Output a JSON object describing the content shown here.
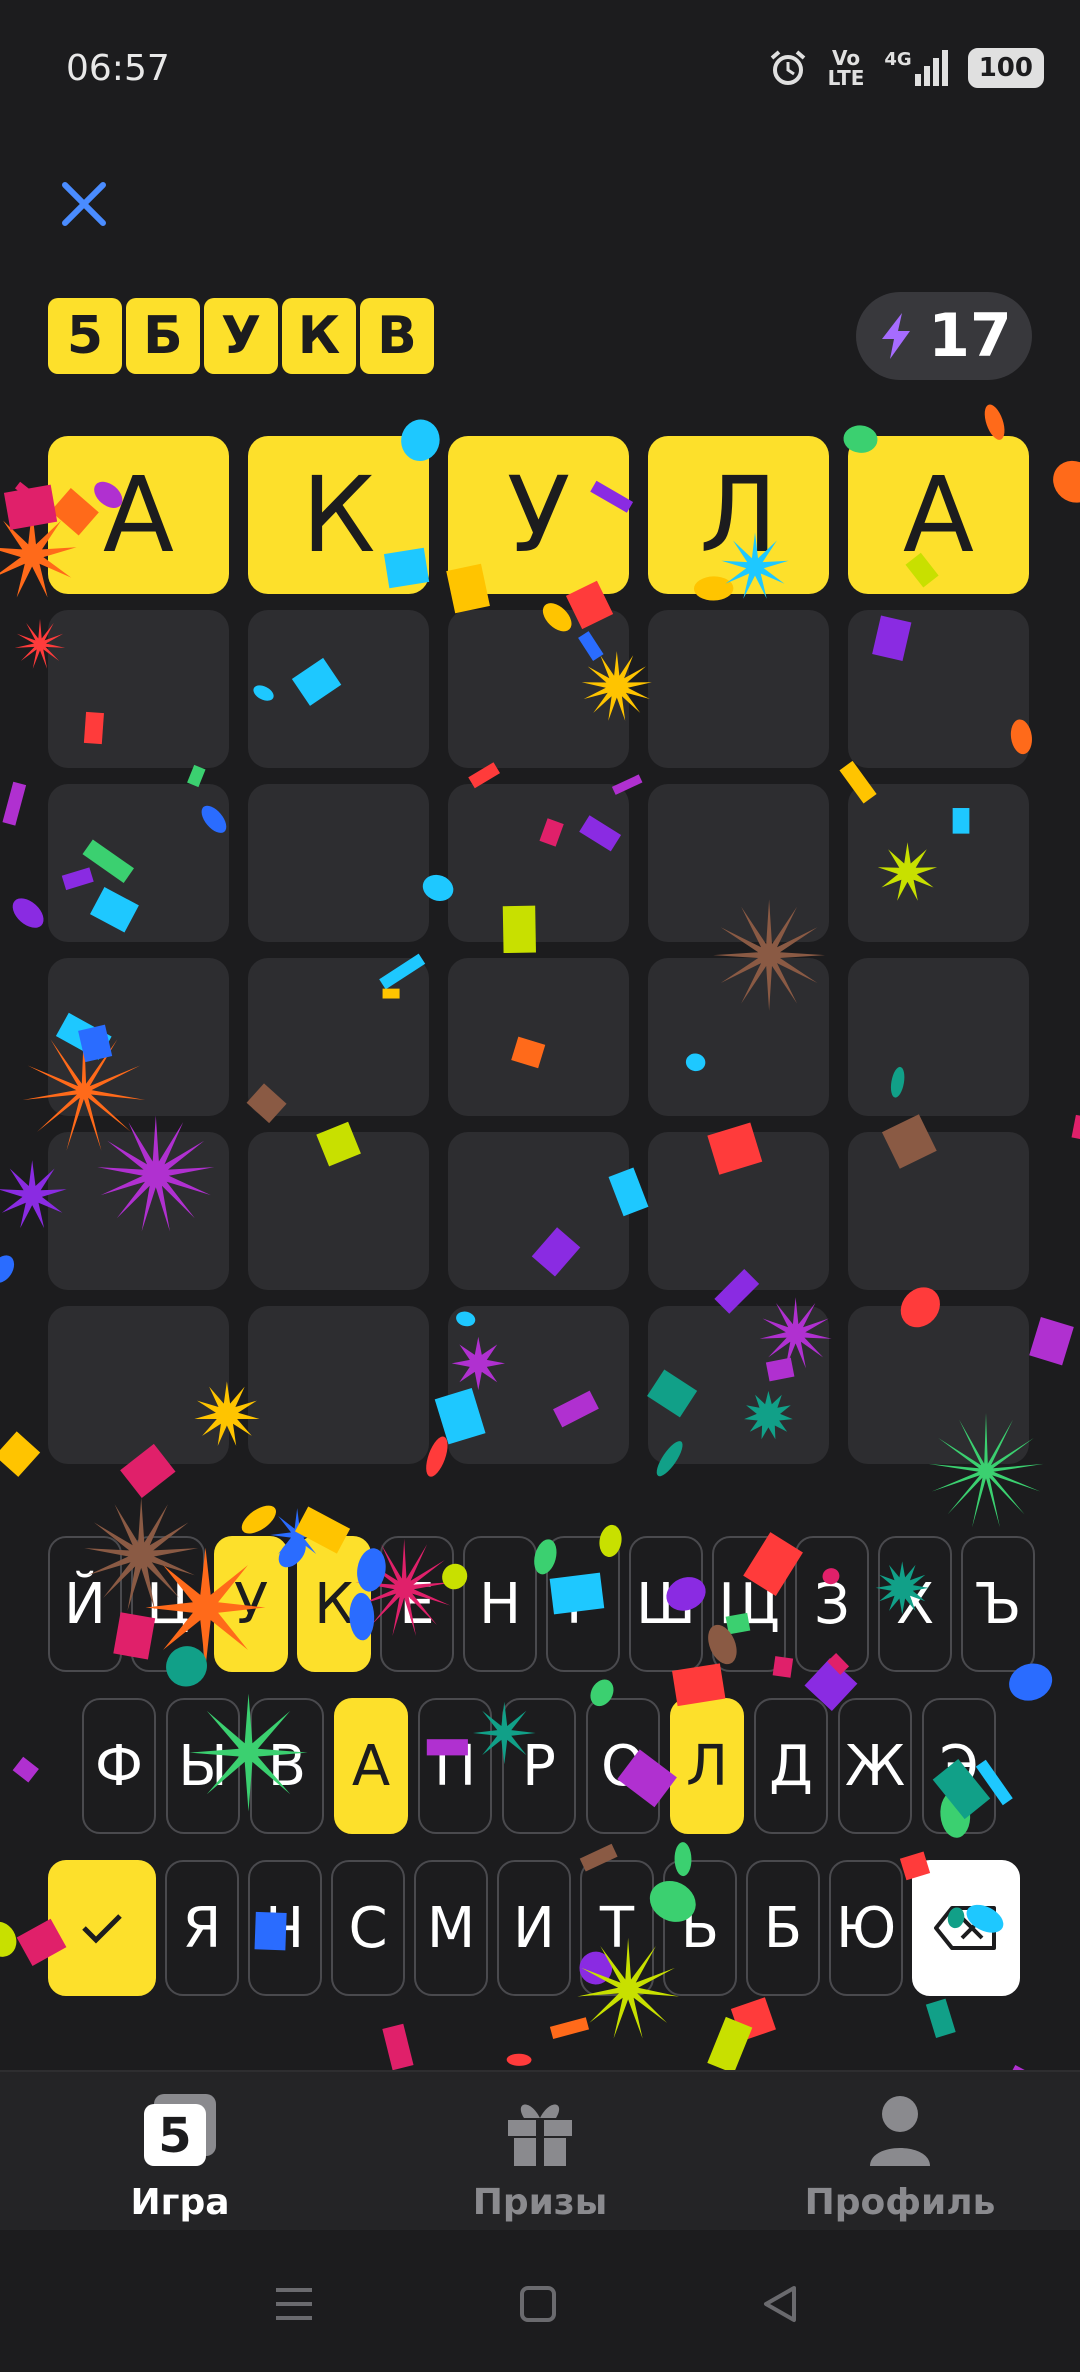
{
  "status_bar": {
    "time": "06:57",
    "volte": "Vo\nLTE",
    "network": "4G",
    "battery": "100"
  },
  "header": {
    "logo_letters": [
      "5",
      "Б",
      "У",
      "К",
      "В"
    ],
    "energy": "17"
  },
  "board": {
    "rows": [
      [
        {
          "l": "А",
          "s": "correct"
        },
        {
          "l": "К",
          "s": "correct"
        },
        {
          "l": "У",
          "s": "correct"
        },
        {
          "l": "Л",
          "s": "correct"
        },
        {
          "l": "А",
          "s": "correct"
        }
      ],
      [
        {
          "l": "",
          "s": "empty"
        },
        {
          "l": "",
          "s": "empty"
        },
        {
          "l": "",
          "s": "empty"
        },
        {
          "l": "",
          "s": "empty"
        },
        {
          "l": "",
          "s": "empty"
        }
      ],
      [
        {
          "l": "",
          "s": "empty"
        },
        {
          "l": "",
          "s": "empty"
        },
        {
          "l": "",
          "s": "empty"
        },
        {
          "l": "",
          "s": "empty"
        },
        {
          "l": "",
          "s": "empty"
        }
      ],
      [
        {
          "l": "",
          "s": "empty"
        },
        {
          "l": "",
          "s": "empty"
        },
        {
          "l": "",
          "s": "empty"
        },
        {
          "l": "",
          "s": "empty"
        },
        {
          "l": "",
          "s": "empty"
        }
      ],
      [
        {
          "l": "",
          "s": "empty"
        },
        {
          "l": "",
          "s": "empty"
        },
        {
          "l": "",
          "s": "empty"
        },
        {
          "l": "",
          "s": "empty"
        },
        {
          "l": "",
          "s": "empty"
        }
      ],
      [
        {
          "l": "",
          "s": "empty"
        },
        {
          "l": "",
          "s": "empty"
        },
        {
          "l": "",
          "s": "empty"
        },
        {
          "l": "",
          "s": "empty"
        },
        {
          "l": "",
          "s": "empty"
        }
      ]
    ]
  },
  "keyboard": {
    "row1": [
      "Й",
      "Ц",
      "У",
      "К",
      "Е",
      "Н",
      "Г",
      "Ш",
      "Щ",
      "З",
      "Х",
      "Ъ"
    ],
    "row2": [
      "Ф",
      "Ы",
      "В",
      "А",
      "П",
      "Р",
      "О",
      "Л",
      "Д",
      "Ж",
      "Э"
    ],
    "row3": [
      "Я",
      "Ч",
      "С",
      "М",
      "И",
      "Т",
      "Ь",
      "Б",
      "Ю"
    ],
    "highlighted": [
      "У",
      "К",
      "А",
      "Л"
    ],
    "enter_icon": "check-icon",
    "backspace_icon": "backspace-icon"
  },
  "nav": {
    "items": [
      {
        "label": "Игра",
        "icon": "game-5-icon",
        "active": true
      },
      {
        "label": "Призы",
        "icon": "gift-icon",
        "active": false
      },
      {
        "label": "Профиль",
        "icon": "profile-icon",
        "active": false
      }
    ]
  },
  "colors": {
    "accent": "#fde02b",
    "background": "#1c1c1e",
    "cell_empty": "#2d2d30",
    "energy_icon": "#a66cff"
  }
}
